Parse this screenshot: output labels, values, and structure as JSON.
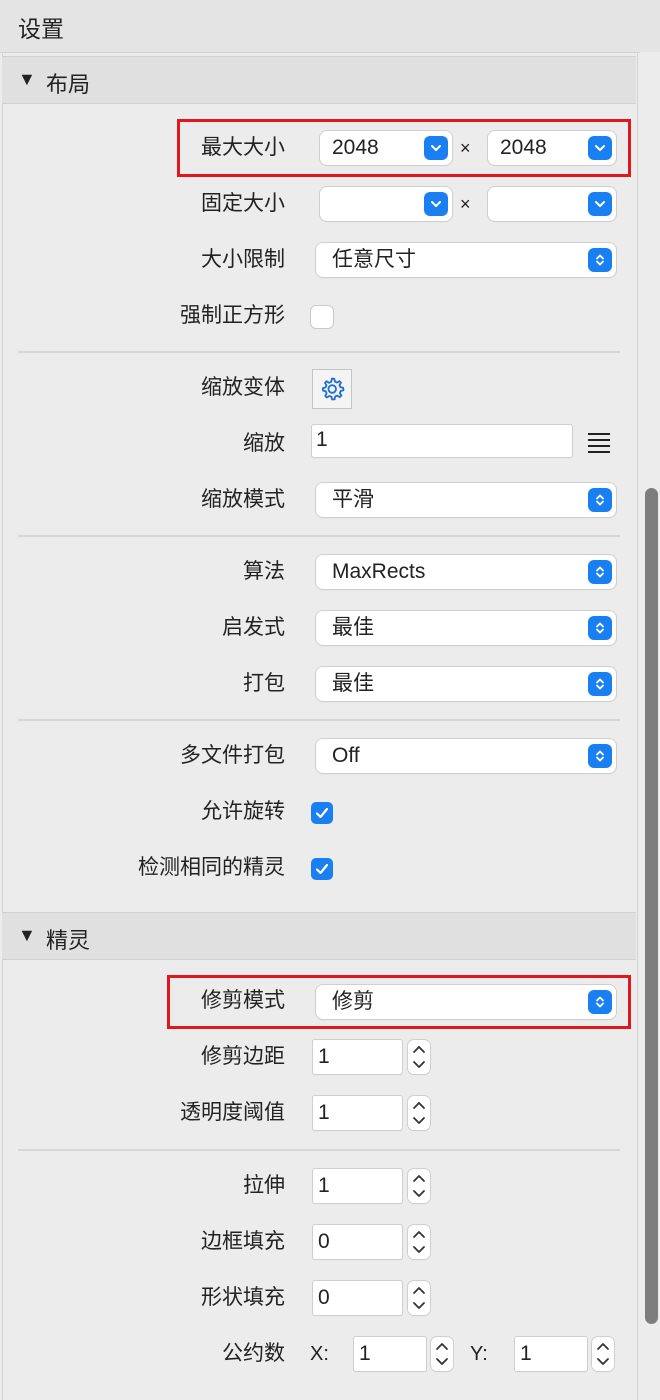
{
  "window": {
    "title": "设置"
  },
  "sections": {
    "layout": {
      "label": "布局"
    },
    "sprites": {
      "label": "精灵"
    }
  },
  "icons": {
    "section_toggle": "disclosure-triangle-down-icon",
    "combo_arrow": "chevron-down-icon",
    "popup_arrows": "up-down-chevron-icon",
    "gear": "gear-icon",
    "menu": "hamburger-menu-icon",
    "stepper": "stepper-up-down-icon",
    "check": "checkmark-icon"
  },
  "colors": {
    "accent": "#1a7ff0",
    "highlight": "#e0171c",
    "scrollbar": "#7d7d7d"
  },
  "layout": {
    "max_size": {
      "label": "最大大小",
      "width": "2048",
      "height": "2048",
      "separator": "×"
    },
    "fixed_size": {
      "label": "固定大小",
      "width": "",
      "height": "",
      "separator": "×"
    },
    "size_constraint": {
      "label": "大小限制",
      "value": "任意尺寸"
    },
    "force_square": {
      "label": "强制正方形",
      "checked": false
    },
    "scale_variants": {
      "label": "缩放变体"
    },
    "scale": {
      "label": "缩放",
      "value": "1"
    },
    "scale_mode": {
      "label": "缩放模式",
      "value": "平滑"
    },
    "algorithm": {
      "label": "算法",
      "value": "MaxRects"
    },
    "heuristic": {
      "label": "启发式",
      "value": "最佳"
    },
    "pack": {
      "label": "打包",
      "value": "最佳"
    },
    "multipack": {
      "label": "多文件打包",
      "value": "Off"
    },
    "allow_rotation": {
      "label": "允许旋转",
      "checked": true
    },
    "detect_identical": {
      "label": "检测相同的精灵",
      "checked": true
    }
  },
  "sprites": {
    "trim_mode": {
      "label": "修剪模式",
      "value": "修剪"
    },
    "trim_margin": {
      "label": "修剪边距",
      "value": "1"
    },
    "alpha_threshold": {
      "label": "透明度阈值",
      "value": "1"
    },
    "extrude": {
      "label": "拉伸",
      "value": "1"
    },
    "border_padding": {
      "label": "边框填充",
      "value": "0"
    },
    "shape_padding": {
      "label": "形状填充",
      "value": "0"
    },
    "common_divisor": {
      "label": "公约数",
      "x_label": "X:",
      "x_value": "1",
      "y_label": "Y:",
      "y_value": "1"
    }
  }
}
